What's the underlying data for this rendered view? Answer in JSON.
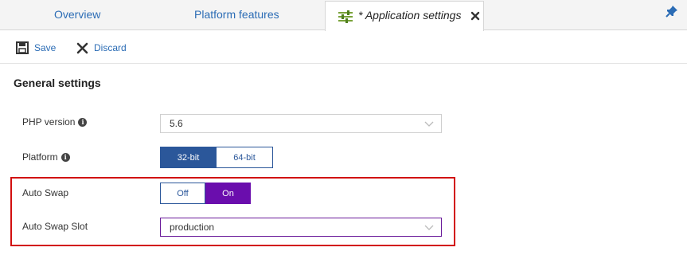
{
  "tabs": {
    "overview": "Overview",
    "platform_features": "Platform features",
    "active": "* Application settings"
  },
  "toolbar": {
    "save_label": "Save",
    "discard_label": "Discard"
  },
  "general": {
    "title": "General settings",
    "php_version": {
      "label": "PHP version",
      "value": "5.6"
    },
    "platform": {
      "label": "Platform",
      "options": [
        "32-bit",
        "64-bit"
      ],
      "selected": "32-bit"
    },
    "auto_swap": {
      "label": "Auto Swap",
      "options": [
        "Off",
        "On"
      ],
      "selected": "On"
    },
    "auto_swap_slot": {
      "label": "Auto Swap Slot",
      "value": "production"
    }
  },
  "colors": {
    "link": "#2b6cb5",
    "platform_selected": "#2b579a",
    "swap_selected": "#6a0dad",
    "highlight": "#d20f0f"
  },
  "icons": [
    "settings-icon",
    "close-icon",
    "pin-icon",
    "save-icon",
    "discard-icon",
    "info-icon",
    "chevron-down-icon"
  ]
}
